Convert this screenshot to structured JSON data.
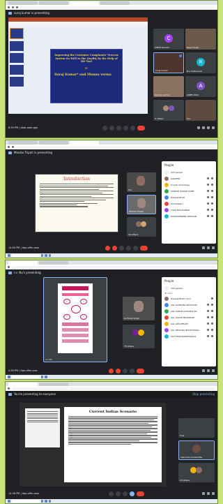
{
  "s1": {
    "presenter": "suraj kumar is presenting",
    "slide": {
      "title": "Improving the Customer Complaints' Process System So Well as the Quality by the Help of RR Tool",
      "by": "BY",
      "authors": "Suraj Kumar* and Munna verma"
    },
    "tiles": [
      {
        "name": "CSMIT Parvati",
        "letter": "C",
        "color": "#a142f4"
      },
      {
        "name": "Payal Singh",
        "letter": "",
        "color": "#8d6e63"
      },
      {
        "name": "suraj kumar",
        "letter": "",
        "color": "#5d4037"
      },
      {
        "name": "R.s chaturvedi",
        "letter": "R",
        "color": "#12b5cb"
      },
      {
        "name": "munna verma",
        "letter": "",
        "color": "#795548"
      },
      {
        "name": "AMEE 2022",
        "letter": "A",
        "color": "#7e57c2"
      },
      {
        "name": "3 others",
        "letter": "",
        "color": "#5f6368"
      },
      {
        "name": "You",
        "letter": "",
        "color": "#6d4c41"
      }
    ],
    "time": "6:30 PM | atab-oper-qqs"
  },
  "s2": {
    "presenter": "Monika Tripati is presenting",
    "slide": {
      "title": "Introduction"
    },
    "tiles": [
      {
        "name": "You"
      },
      {
        "name": "Monika Tripati"
      },
      {
        "name": "30 others"
      }
    ],
    "panel_title": "People",
    "people": [
      "Add people",
      "JAGCEER",
      "Suresh Chandaiya",
      "SURESH KUMAR DUBE",
      "Deepak Bhati",
      "Kamadeeku",
      "LAKIT BALAYANGE",
      "RAGHAVENDRA MADAAN"
    ],
    "time": "12:05 PM | itqu-vffm-oxw"
  },
  "s3": {
    "presenter": "r.v. Nu's presenting",
    "tiles": [
      {
        "name": "r.v. Nu"
      },
      {
        "name": "Archana Singh"
      },
      {
        "name": "79 others"
      }
    ],
    "panel_title": "People",
    "section": "IN CALL",
    "people": [
      "Add people",
      "Deepak Bhati (You)",
      "AGL ASHRUBA MOHIYOTA",
      "AGL KARAN GOHANTI MA",
      "AGL AKASH BHANDARY",
      "AGL ARIA BHART",
      "AGL DEVIARA BOOTSTANAL",
      "AGT SHAN BANSTANAAL"
    ],
    "time": "2:30 PM | itqu-vffm-oxw"
  },
  "s4": {
    "presenter": "You're presenting to everyone",
    "stop": "Stop presenting",
    "slide": {
      "title": "Current Indian Scenario"
    },
    "tiles": [
      {
        "name": "Tina"
      },
      {
        "name": "Adarrunsh Annapuratha"
      },
      {
        "name": "24 others"
      }
    ],
    "time": "12:36 PM | itqu-vffm-oxw"
  }
}
